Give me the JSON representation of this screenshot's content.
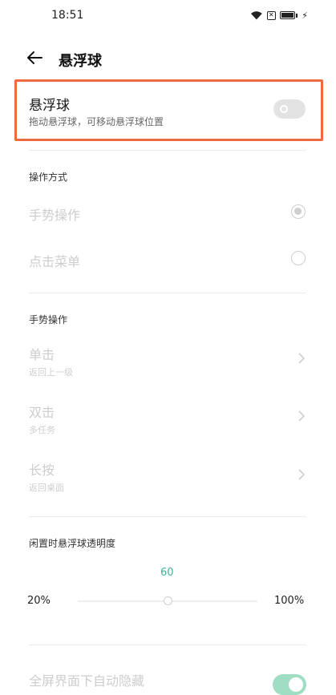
{
  "status_bar": {
    "time": "18:51",
    "icons": [
      "wifi-icon",
      "sim-icon",
      "battery-icon",
      "charging-icon"
    ]
  },
  "header": {
    "back_icon": "back-arrow-icon",
    "title": "悬浮球"
  },
  "main_toggle": {
    "title": "悬浮球",
    "subtitle": "拖动悬浮球，可移动悬浮球位置",
    "enabled": false,
    "highlight_color": "#ef6b3f"
  },
  "operation_mode": {
    "section_title": "操作方式",
    "options": [
      {
        "label": "手势操作",
        "selected": true
      },
      {
        "label": "点击菜单",
        "selected": false
      }
    ]
  },
  "gesture": {
    "section_title": "手势操作",
    "items": [
      {
        "label": "单击",
        "value": "返回上一级"
      },
      {
        "label": "双击",
        "value": "多任务"
      },
      {
        "label": "长按",
        "value": "返回桌面"
      }
    ]
  },
  "opacity": {
    "section_title": "闲置时悬浮球透明度",
    "value": "60",
    "min_label": "20%",
    "max_label": "100%",
    "min": 20,
    "max": 100,
    "current": 60,
    "accent": "#3fb39a"
  },
  "auto_hide": {
    "label": "全屏界面下自动隐藏",
    "enabled": true,
    "color": "#9fdec3"
  }
}
